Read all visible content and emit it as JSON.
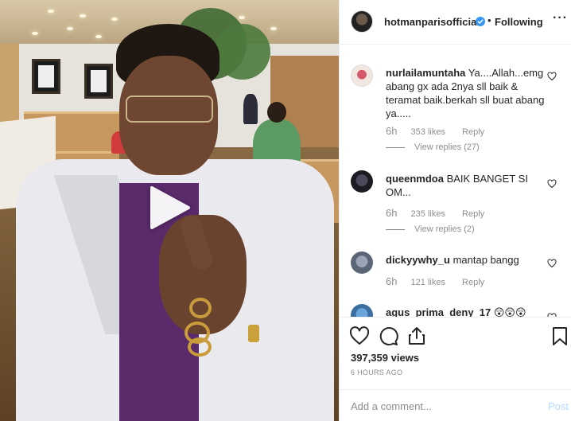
{
  "video": {
    "play_icon": "play-icon",
    "scene": "man-in-restaurant-video-frame"
  },
  "header": {
    "username": "hotmanparisofficial",
    "verified_icon": "verified-badge-icon",
    "separator": "•",
    "follow_status": "Following",
    "more_label": "···"
  },
  "comments": [
    {
      "user": "nurlailamuntaha",
      "text": "Ya....Allah...emg abang gx ada 2nya sll baik & teramat baik.berkah sll buat abang ya.....",
      "time": "6h",
      "likes": "353 likes",
      "reply_label": "Reply",
      "view_replies": "View replies (27)"
    },
    {
      "user": "queenmdoa",
      "text": "BAIK BANGET SI OM...",
      "time": "6h",
      "likes": "235 likes",
      "reply_label": "Reply",
      "view_replies": "View replies (2)"
    },
    {
      "user": "dickyywhy_u",
      "text": "mantap bangg",
      "time": "6h",
      "likes": "121 likes",
      "reply_label": "Reply"
    },
    {
      "user": "agus_prima_deny_17",
      "text": "😲😲😲"
    }
  ],
  "actions": {
    "like_icon": "heart-icon",
    "comment_icon": "comment-bubble-icon",
    "share_icon": "share-icon",
    "save_icon": "bookmark-icon",
    "views": "397,359 views",
    "posted": "6 HOURS AGO"
  },
  "add_comment": {
    "placeholder": "Add a comment...",
    "post_label": "Post"
  },
  "colors": {
    "text": "#262626",
    "muted": "#8e8e8e",
    "verified": "#3897f0",
    "post_disabled": "#b3dbff",
    "border": "#efefef"
  }
}
